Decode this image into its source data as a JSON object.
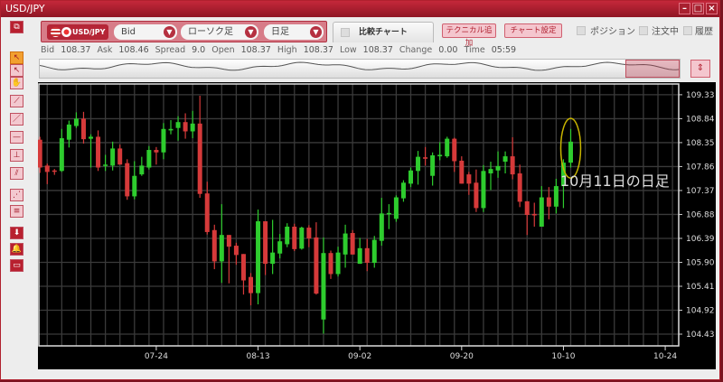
{
  "window": {
    "title": "USD/JPY",
    "min": "–",
    "max": "□",
    "close": "×"
  },
  "controls": {
    "pair": "USD/JPY",
    "price_type": "Bid",
    "chart_type": "ローソク足",
    "period": "日足",
    "compare_tab": "比較チャート",
    "add_technical": "テクニカル追加",
    "chart_settings": "チャート設定",
    "chk_position": "ポジション",
    "chk_orders": "注文中",
    "chk_history": "履歴"
  },
  "info": [
    {
      "k": "Bid",
      "v": "108.37"
    },
    {
      "k": "Ask",
      "v": "108.46"
    },
    {
      "k": "Spread",
      "v": "9.0"
    },
    {
      "k": "Open",
      "v": "108.37"
    },
    {
      "k": "High",
      "v": "108.37"
    },
    {
      "k": "Low",
      "v": "108.37"
    },
    {
      "k": "Change",
      "v": "0.00"
    },
    {
      "k": "Time",
      "v": "05:59"
    }
  ],
  "annotation": "10月11日の日足",
  "colors": {
    "up": "#2ecc2e",
    "down": "#d63a3a",
    "highlight": "#c8b400",
    "accent": "#b52536"
  },
  "toolbar_icons": [
    "window-switch-icon",
    "pointer-icon",
    "pointer-plus-icon",
    "hand-icon",
    "trendline-icon",
    "line-icon",
    "horizontal-line-icon",
    "vertical-line-icon",
    "parallel-line-icon",
    "fibonacci-icon",
    "channel-icon",
    "download-icon",
    "alert-bell-icon",
    "table-icon"
  ],
  "chart_data": {
    "type": "candlestick",
    "ylim": [
      104.19,
      109.55
    ],
    "yticks": [
      "109.33",
      "108.84",
      "108.35",
      "107.86",
      "107.37",
      "106.88",
      "106.39",
      "105.90",
      "105.41",
      "104.92",
      "104.43"
    ],
    "xticks": [
      {
        "label": "07-24",
        "candle": 16
      },
      {
        "label": "08-13",
        "candle": 30
      },
      {
        "label": "09-02",
        "candle": 44
      },
      {
        "label": "09-20",
        "candle": 58
      },
      {
        "label": "10-10",
        "candle": 72
      },
      {
        "label": "10-24",
        "candle": 86
      }
    ],
    "grid": true,
    "highlighted_candle": 73,
    "ohlc": [
      [
        108.41,
        108.47,
        107.73,
        107.84
      ],
      [
        107.88,
        107.92,
        107.5,
        107.75
      ],
      [
        107.78,
        107.81,
        107.69,
        107.77
      ],
      [
        107.77,
        108.63,
        107.75,
        108.44
      ],
      [
        108.41,
        108.8,
        108.25,
        108.72
      ],
      [
        108.69,
        108.97,
        108.65,
        108.84
      ],
      [
        108.84,
        108.98,
        108.33,
        108.42
      ],
      [
        108.43,
        108.52,
        107.84,
        108.47
      ],
      [
        108.47,
        108.6,
        107.77,
        107.84
      ],
      [
        107.88,
        108.1,
        107.77,
        107.9
      ],
      [
        107.88,
        108.37,
        107.78,
        108.23
      ],
      [
        108.23,
        108.31,
        107.9,
        107.9
      ],
      [
        107.93,
        108.01,
        107.18,
        107.25
      ],
      [
        107.25,
        107.97,
        107.19,
        107.67
      ],
      [
        107.7,
        108.06,
        107.67,
        107.88
      ],
      [
        107.84,
        108.28,
        107.8,
        108.2
      ],
      [
        108.2,
        108.26,
        107.9,
        108.15
      ],
      [
        108.15,
        108.75,
        108.01,
        108.63
      ],
      [
        108.6,
        108.81,
        108.52,
        108.63
      ],
      [
        108.65,
        108.89,
        108.39,
        108.77
      ],
      [
        108.77,
        108.95,
        108.43,
        108.58
      ],
      [
        108.58,
        109.0,
        108.44,
        108.74
      ],
      [
        108.74,
        109.31,
        107.22,
        107.3
      ],
      [
        107.31,
        107.55,
        106.47,
        106.52
      ],
      [
        106.56,
        106.67,
        105.76,
        105.92
      ],
      [
        105.92,
        107.09,
        105.48,
        106.46
      ],
      [
        106.46,
        106.46,
        105.47,
        106.22
      ],
      [
        106.24,
        106.3,
        105.85,
        106.05
      ],
      [
        106.07,
        106.07,
        105.24,
        105.53
      ],
      [
        105.6,
        105.68,
        105.02,
        105.27
      ],
      [
        105.27,
        106.98,
        105.04,
        106.74
      ],
      [
        106.74,
        106.74,
        105.64,
        105.87
      ],
      [
        105.87,
        106.77,
        105.66,
        106.1
      ],
      [
        106.08,
        106.48,
        105.98,
        106.33
      ],
      [
        106.27,
        106.7,
        106.21,
        106.63
      ],
      [
        106.63,
        106.69,
        106.13,
        106.17
      ],
      [
        106.18,
        106.63,
        106.16,
        106.61
      ],
      [
        106.61,
        106.66,
        106.21,
        106.39
      ],
      [
        106.41,
        106.72,
        105.24,
        105.26
      ],
      [
        104.73,
        106.41,
        104.44,
        106.09
      ],
      [
        106.09,
        106.14,
        105.56,
        105.66
      ],
      [
        105.66,
        106.22,
        105.61,
        106.1
      ],
      [
        106.06,
        106.67,
        105.79,
        106.49
      ],
      [
        106.5,
        106.56,
        106.06,
        106.06
      ],
      [
        105.87,
        106.4,
        105.87,
        106.19
      ],
      [
        106.19,
        106.38,
        105.72,
        105.89
      ],
      [
        105.89,
        106.44,
        105.79,
        106.36
      ],
      [
        106.34,
        107.22,
        106.24,
        106.9
      ],
      [
        106.89,
        107.09,
        106.58,
        106.91
      ],
      [
        106.79,
        107.27,
        106.73,
        107.23
      ],
      [
        107.21,
        107.58,
        107.14,
        107.53
      ],
      [
        107.51,
        107.84,
        107.44,
        107.78
      ],
      [
        107.77,
        108.18,
        107.49,
        108.06
      ],
      [
        108.05,
        108.26,
        107.88,
        108.02
      ],
      [
        107.67,
        108.15,
        107.47,
        108.09
      ],
      [
        108.07,
        108.36,
        107.99,
        108.1
      ],
      [
        108.07,
        108.47,
        108.04,
        108.43
      ],
      [
        108.43,
        108.45,
        107.75,
        107.97
      ],
      [
        107.98,
        108.07,
        107.51,
        107.51
      ],
      [
        107.7,
        107.75,
        107.28,
        107.51
      ],
      [
        107.53,
        107.8,
        106.93,
        107.01
      ],
      [
        107.01,
        107.89,
        106.93,
        107.77
      ],
      [
        107.72,
        107.96,
        107.38,
        107.81
      ],
      [
        107.78,
        108.17,
        107.63,
        107.87
      ],
      [
        107.96,
        108.17,
        107.72,
        108.07
      ],
      [
        108.07,
        108.46,
        107.6,
        107.7
      ],
      [
        107.72,
        107.9,
        107.03,
        107.14
      ],
      [
        107.15,
        107.15,
        106.46,
        106.87
      ],
      [
        106.89,
        107.12,
        106.63,
        106.86
      ],
      [
        106.63,
        107.46,
        106.63,
        107.23
      ],
      [
        107.23,
        107.44,
        106.78,
        107.04
      ],
      [
        107.04,
        107.61,
        106.9,
        107.46
      ],
      [
        107.46,
        108.01,
        107.01,
        107.94
      ],
      [
        107.94,
        108.63,
        107.84,
        108.37
      ]
    ]
  }
}
